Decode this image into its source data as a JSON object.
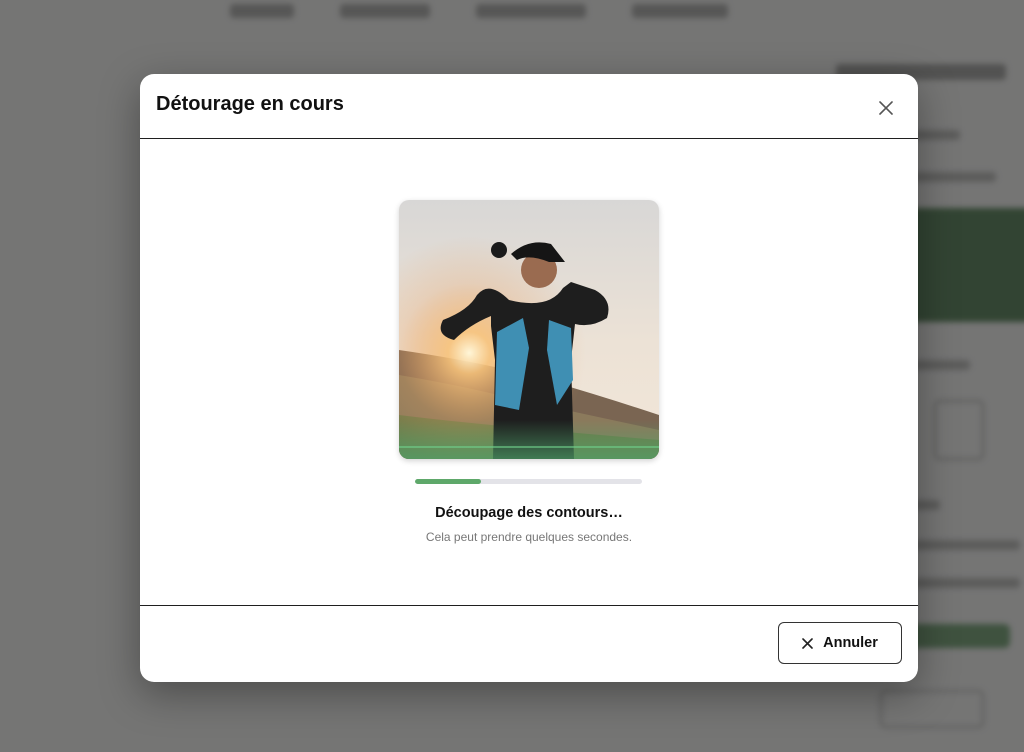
{
  "modal": {
    "title": "Détourage en cours",
    "close_icon": "close-icon",
    "progress_fraction": 0.29,
    "status": "Découpage des contours…",
    "subtext": "Cela peut prendre quelques secondes.",
    "cancel_label": "Annuler",
    "cancel_icon": "close-icon"
  },
  "colors": {
    "accent": "#5ea86a",
    "overlay": "#2d2d2d",
    "progress_track": "#e3e3e8"
  }
}
